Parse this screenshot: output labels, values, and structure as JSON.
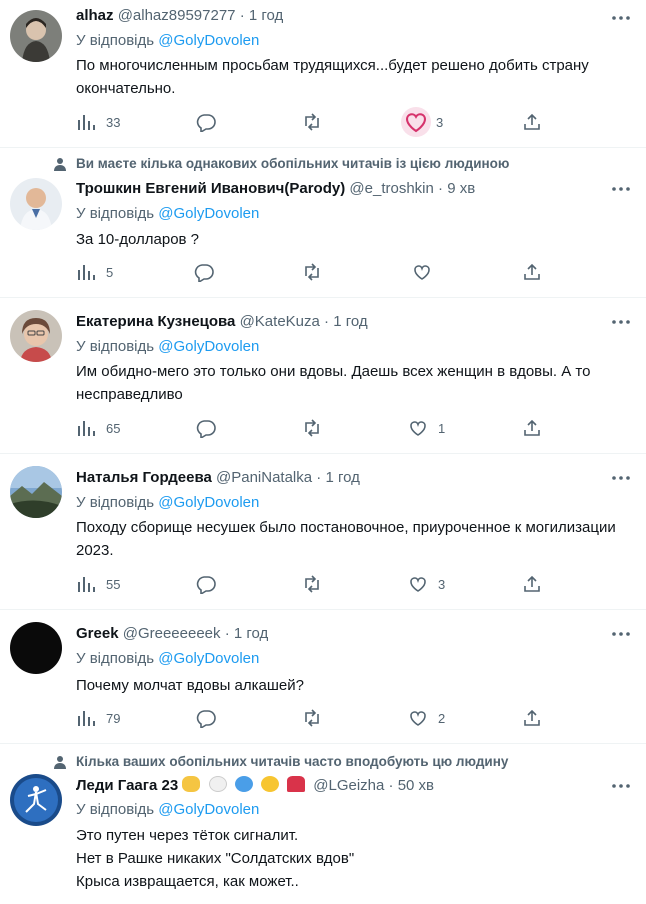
{
  "colors": {
    "accent": "#1d9bf0",
    "muted": "#536471",
    "text": "#0f1419",
    "liked_bg": "#f9e0ea"
  },
  "icons": {
    "views": "bar-chart-icon",
    "reply": "speech-bubble-icon",
    "retweet": "retweet-arrows-icon",
    "like": "heart-icon",
    "share": "share-upload-icon",
    "more": "three-dots-icon",
    "social": "person-icon"
  },
  "tweets": [
    {
      "name": "alhaz",
      "handle": "@alhaz89597277",
      "time": "1 год",
      "reply_label": "У відповідь",
      "reply_handle": "@GolyDovolen",
      "text": "По многочисленным просьбам трудящихся...будет решено добить страну окончательно.",
      "views": "33",
      "likes": "3",
      "liked_hover": true
    },
    {
      "social_context": "Ви маєте кілька однакових обопільних читачів із цією людиною",
      "name": "Трошкин Евгений Иванович(Parody)",
      "handle": "@e_troshkin",
      "time": "9 хв",
      "reply_label": "У відповідь",
      "reply_handle": "@GolyDovolen",
      "text": "За 10-долларов ?",
      "views": "5",
      "likes": ""
    },
    {
      "name": "Екатерина Кузнецова",
      "handle": "@KateKuza",
      "time": "1 год",
      "reply_label": "У відповідь",
      "reply_handle": "@GolyDovolen",
      "text": "Им обидно-мего это только они вдовы. Даешь всех женщин в вдовы. А то несправедливо",
      "views": "65",
      "likes": "1"
    },
    {
      "name": "Наталья Гордеева",
      "handle": "@PaniNatalka",
      "time": "1 год",
      "reply_label": "У відповідь",
      "reply_handle": "@GolyDovolen",
      "text": "Походу сборище несушек было постановочное, приуроченное к могилизации 2023.",
      "views": "55",
      "likes": "3"
    },
    {
      "name": "Greek",
      "handle": "@Greeeeeeek",
      "time": "1 год",
      "reply_label": "У відповідь",
      "reply_handle": "@GolyDovolen",
      "text": "Почему молчат вдовы алкашей?",
      "views": "79",
      "likes": "2"
    },
    {
      "social_context": "Кілька ваших обопільних читачів часто вподобують цю людину",
      "name": "Леди Гаага 23",
      "name_emojis": [
        "victory-hand",
        "white-heart",
        "blue-heart",
        "yellow-heart",
        "dancer"
      ],
      "handle": "@LGeizha",
      "time": "50 хв",
      "reply_label": "У відповідь",
      "reply_handle": "@GolyDovolen",
      "text": "Это путен через тёток сигналит.\nНет в Рашке никаких \"Солдатских вдов\"\nКрыса извращается, как может.."
    }
  ]
}
